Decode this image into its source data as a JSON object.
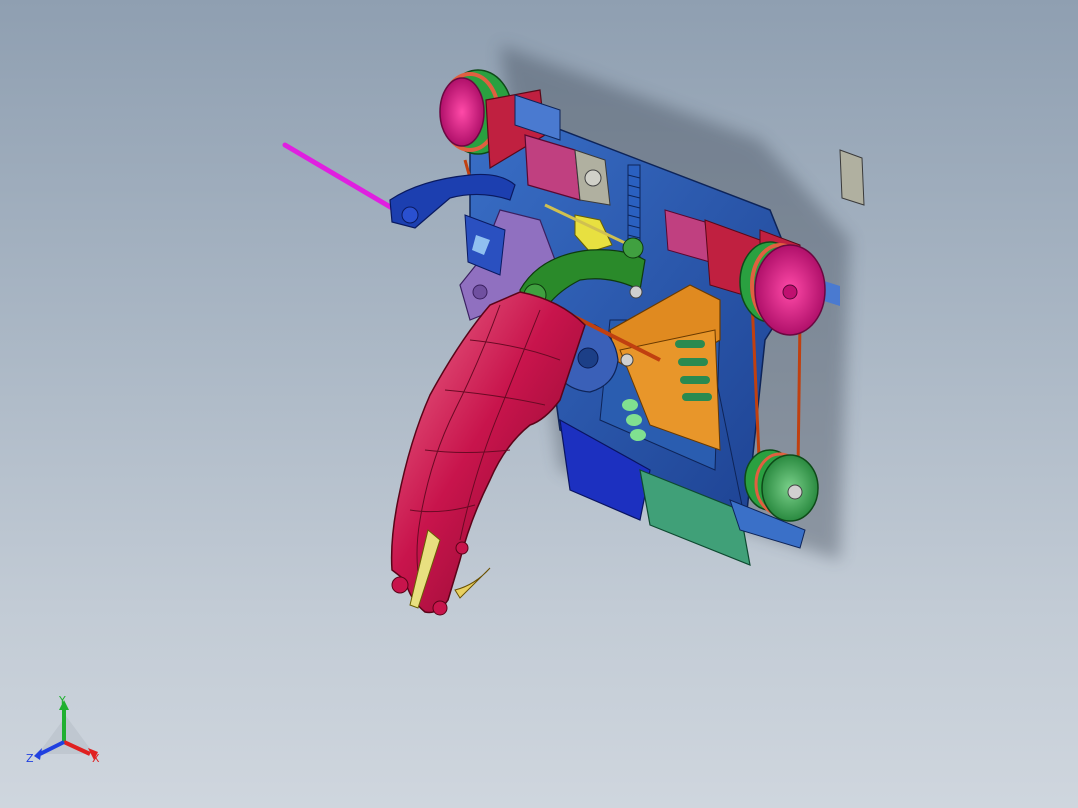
{
  "viewport": {
    "background_top": "#8f9fb1",
    "background_bottom": "#cfd6de"
  },
  "triad": {
    "x_label": "X",
    "y_label": "Y",
    "z_label": "Z",
    "x_color": "#e02020",
    "y_color": "#20b030",
    "z_color": "#2040e0"
  },
  "model": {
    "icon": "cad-assembly-model",
    "colors": {
      "frame": "#2e5fb5",
      "frame_dark": "#1c3f87",
      "handle": "#c8144c",
      "handle_light": "#e8506f",
      "pulley": "#e0208a",
      "pulley_ring": "#e06040",
      "motor": "#c02040",
      "motor_face": "#a0a0a0",
      "arm_green": "#2a8a2a",
      "arm_blue": "#1c3fb0",
      "purple": "#9070c0",
      "orange": "#e08a20",
      "yellow": "#e8e040",
      "teal": "#40a078",
      "rod": "#e020e0",
      "belt": "#c04010"
    }
  }
}
